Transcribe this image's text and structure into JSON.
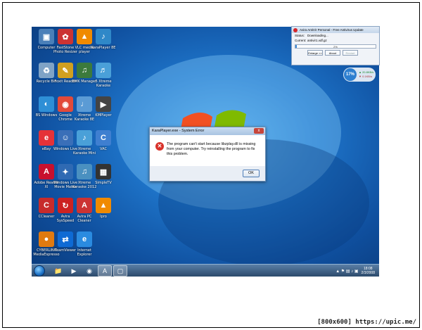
{
  "desktop_icons": [
    {
      "label": "Computer",
      "name": "computer-icon",
      "color": "#4a7fb8",
      "glyph": "▣"
    },
    {
      "label": "FastStone Photo Resizer",
      "name": "faststone-icon",
      "color": "#c33",
      "glyph": "✿"
    },
    {
      "label": "VLC media player",
      "name": "vlc-icon",
      "color": "#f08a00",
      "glyph": "▲"
    },
    {
      "label": "KaraPlayer 8E",
      "name": "karaplayer-icon",
      "color": "#2f88c8",
      "glyph": "♪"
    },
    {
      "label": "Recycle Bin",
      "name": "recycle-bin-icon",
      "color": "#7fa3c6",
      "glyph": "♻"
    },
    {
      "label": "Foxit Reader",
      "name": "foxit-icon",
      "color": "#d0a020",
      "glyph": "✎"
    },
    {
      "label": "EMK Manager",
      "name": "emk-manager-icon",
      "color": "#3c7a3c",
      "glyph": "♫"
    },
    {
      "label": "5 Xtreme Karaoke",
      "name": "xtreme-karaoke-icon",
      "color": "#4aa0d8",
      "glyph": "♬"
    },
    {
      "label": "BS Windows",
      "name": "bs-windows-icon",
      "color": "#2e8fd6",
      "glyph": "◐"
    },
    {
      "label": "Google Chrome",
      "name": "chrome-icon",
      "color": "#e24a3a",
      "glyph": "◉"
    },
    {
      "label": "Xtreme Karaoke 8E",
      "name": "xtreme-karaoke-8e-icon",
      "color": "#5b9bd5",
      "glyph": "♩"
    },
    {
      "label": "KMPlayer",
      "name": "kmplayer-icon",
      "color": "#444",
      "glyph": "▶"
    },
    {
      "label": "eBay",
      "name": "ebay-icon",
      "color": "#e53238",
      "glyph": "e"
    },
    {
      "label": "Windows Live",
      "name": "windows-live-icon",
      "color": "#3a6fb8",
      "glyph": "☺"
    },
    {
      "label": "Xtreme Karaoke Mini",
      "name": "xtreme-karaoke-mini-icon",
      "color": "#4aa0d8",
      "glyph": "♪"
    },
    {
      "label": "VAC",
      "name": "vac-icon",
      "color": "#3f7fd0",
      "glyph": "C"
    },
    {
      "label": "Adobe Reader XI",
      "name": "adobe-reader-icon",
      "color": "#c8102e",
      "glyph": "A"
    },
    {
      "label": "Windows Live Movie Maker",
      "name": "movie-maker-icon",
      "color": "#2f6ab3",
      "glyph": "✦"
    },
    {
      "label": "Xtreme Karaoke 2012",
      "name": "xtreme-karaoke-2012-icon",
      "color": "#4a90c0",
      "glyph": "♫"
    },
    {
      "label": "SimpleTV",
      "name": "simpletv-icon",
      "color": "#333",
      "glyph": "▦"
    },
    {
      "label": "CCleaner",
      "name": "ccleaner-icon",
      "color": "#c72b2b",
      "glyph": "C"
    },
    {
      "label": "Avira SysSpeed",
      "name": "avira-sysspeed-icon",
      "color": "#cc2222",
      "glyph": "↻"
    },
    {
      "label": "Avira PC Cleaner",
      "name": "avira-pc-cleaner-icon",
      "color": "#c33",
      "glyph": "A"
    },
    {
      "label": "Ipro",
      "name": "ipro-icon",
      "color": "#f08a00",
      "glyph": "▲"
    },
    {
      "label": "CYBERLINK MediaEspresso",
      "name": "mediaespresso-icon",
      "color": "#e07a10",
      "glyph": "●"
    },
    {
      "label": "TeamViewer",
      "name": "teamviewer-icon",
      "color": "#0e6ad4",
      "glyph": "⇄"
    },
    {
      "label": "Internet Explorer",
      "name": "internet-explorer-icon",
      "color": "#2a8be0",
      "glyph": "e"
    }
  ],
  "error_dialog": {
    "title": "KaraPlayer.exe - System Error",
    "message": "The program can't start because libzplay.dll is missing from your computer. Try reinstalling the program to fix this problem.",
    "ok_label": "OK",
    "close_glyph": "x",
    "icon_glyph": "✕"
  },
  "avira": {
    "title": "Avira AntiVir Personal - Free Antivirus Update",
    "status_key": "Status:",
    "status_val": "Downloading...",
    "current_key": "Current:",
    "current_val": "antivir1.vdf.gz",
    "progress_pct": 0.02,
    "progress_text": "2%",
    "btn_enlarge": "Enlarge >>",
    "btn_about": "About",
    "btn_restart": "Restart"
  },
  "net_meter": {
    "percent": "17%",
    "up": "▲ 20.8KB/s",
    "down": "▼ 0.1KB/s"
  },
  "taskbar": {
    "clock_time": "18:08",
    "clock_date": "2/3/2008",
    "tray_glyphs": "▲ ⚑ ▤ ♪ ▣"
  },
  "watermark": "[800x600] https://upic.me/",
  "colors": {
    "error_red": "#d8322a",
    "desktop_blue": "#1e74c9"
  }
}
